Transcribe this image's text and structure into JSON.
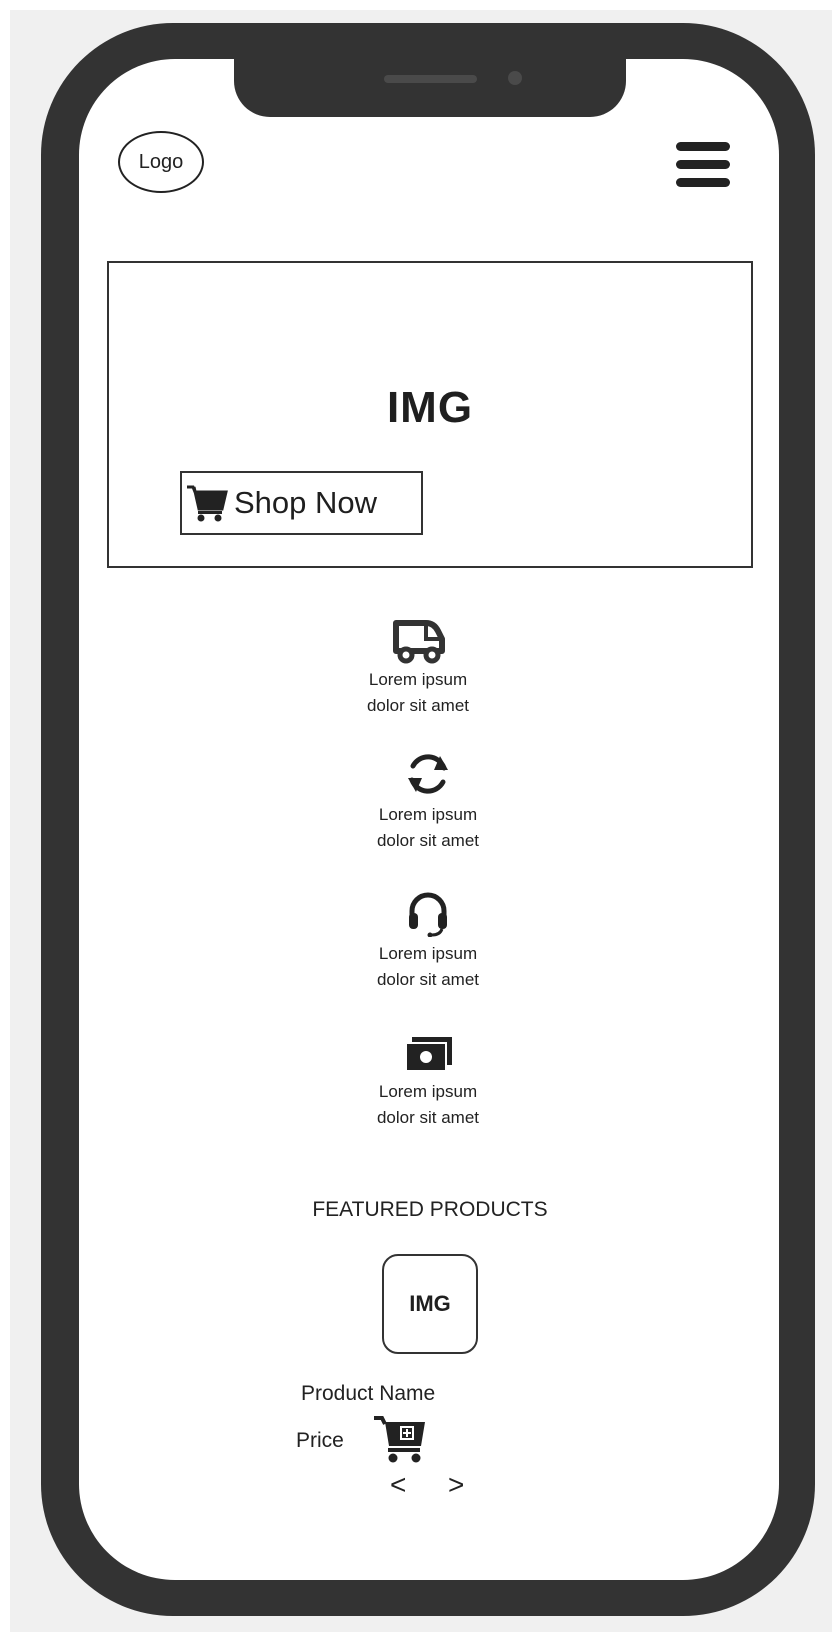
{
  "header": {
    "logo_label": "Logo"
  },
  "hero": {
    "image_label": "IMG",
    "shop_button_label": "Shop Now"
  },
  "features": [
    {
      "icon": "truck-icon",
      "line1": "Lorem ipsum",
      "line2": "dolor sit amet"
    },
    {
      "icon": "refresh-icon",
      "line1": "Lorem ipsum",
      "line2": "dolor sit amet"
    },
    {
      "icon": "headset-icon",
      "line1": "Lorem ipsum",
      "line2": "dolor sit amet"
    },
    {
      "icon": "money-icon",
      "line1": "Lorem ipsum",
      "line2": "dolor sit amet"
    }
  ],
  "featured": {
    "title": "FEATURED PRODUCTS",
    "product": {
      "image_label": "IMG",
      "name": "Product Name",
      "price": "Price"
    },
    "prev_label": "<",
    "next_label": ">"
  },
  "colors": {
    "frame": "#333333",
    "canvas": "#f0f0f0",
    "screen": "#ffffff",
    "text": "#1f1f1f"
  }
}
